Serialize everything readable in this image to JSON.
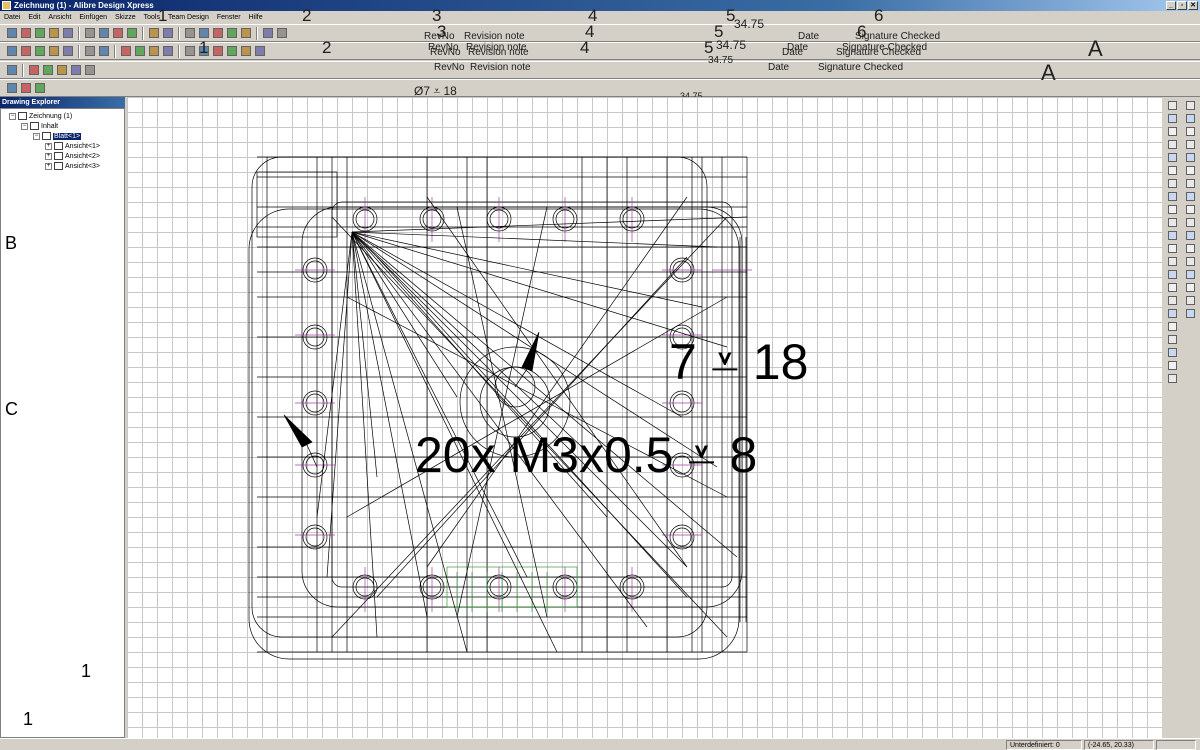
{
  "window": {
    "title": "Zeichnung (1) - Alibre Design Xpress",
    "buttons": [
      "_",
      "▫",
      "✕"
    ]
  },
  "menu": [
    "Datei",
    "Edit",
    "Ansicht",
    "Einfügen",
    "Skizze",
    "Tools",
    "Team Design",
    "Fenster",
    "Hilfe"
  ],
  "revision_overlay": {
    "numbers": [
      "1",
      "2",
      "3",
      "4",
      "5",
      "6"
    ],
    "revno": "RevNo",
    "revision_note": "Revision note",
    "date": "Date",
    "signature_checked": "Signature Checked",
    "dimension": "34.75",
    "zone": "A",
    "callout_small": "Ø7 ⩡ 18"
  },
  "explorer": {
    "title": "Drawing Explorer",
    "tree": [
      {
        "label": "Zeichnung (1)",
        "level": 0,
        "toggle": "−"
      },
      {
        "label": "Inhalt",
        "level": 1,
        "toggle": "−"
      },
      {
        "label": "Blatt<1>",
        "level": 2,
        "toggle": "−",
        "selected": true
      },
      {
        "label": "Ansicht<1>",
        "level": 3,
        "toggle": "+"
      },
      {
        "label": "Ansicht<2>",
        "level": 3,
        "toggle": "+"
      },
      {
        "label": "Ansicht<3>",
        "level": 3,
        "toggle": "+"
      }
    ]
  },
  "sheet_frame": {
    "row_labels": [
      "B",
      "C"
    ],
    "column_label": "1"
  },
  "drawing": {
    "callout_hole": "7 ⩡ 18",
    "callout_thread": "20x M3x0.5 ⩡ 8"
  },
  "icons": {
    "toolbar_row1": [
      "new-icon",
      "open-icon",
      "save-icon",
      "print-icon",
      "print-preview-icon",
      "cut-icon",
      "copy-icon",
      "paste-icon",
      "delete-icon",
      "undo-icon",
      "redo-icon",
      "select-icon",
      "pan-icon",
      "zoom-in-icon",
      "zoom-window-icon",
      "zoom-fit-icon",
      "back-icon",
      "forward-icon"
    ],
    "toolbar_row2": [
      "view-standard-icon",
      "view-projected-icon",
      "view-section-icon",
      "view-detail-icon",
      "view-break-icon",
      "view-auxiliary-icon",
      "view-broken-icon",
      "center-mark-icon",
      "centerline-icon",
      "note-icon",
      "balloon-icon",
      "sketch-line-icon",
      "ellipse-icon",
      "rectangle-icon",
      "text-icon",
      "fill-icon",
      "line-style-icon"
    ],
    "toolbar_row3": [
      "sheet-format-icon",
      "layer-icon",
      "dimension-icon",
      "gdt-icon",
      "weld-icon",
      "surface-finish-icon"
    ],
    "toolbar_row4": [
      "model-icon",
      "sketch-icon",
      "table-icon"
    ]
  },
  "status": {
    "state": "Unterdefiniert: 0",
    "coords": "(-24.65, 20.33)"
  },
  "colors": {
    "title_gradient_start": "#0a246a",
    "title_gradient_end": "#a6caf0",
    "chrome": "#d4d0c8",
    "centerline": "#a040a0",
    "thread_green": "#3a9a3a"
  }
}
